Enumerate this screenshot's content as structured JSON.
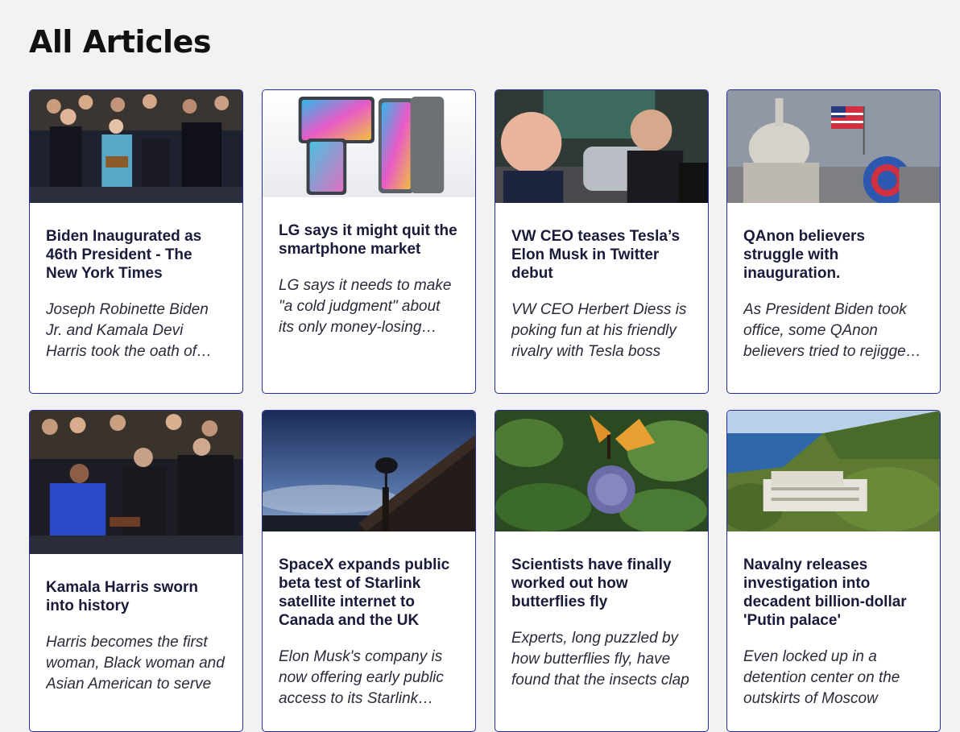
{
  "page": {
    "title": "All Articles"
  },
  "articles": [
    {
      "headline": "Biden Inaugurated as 46th President - The New York Times",
      "description": "Joseph Robinette Biden Jr. and Kamala Devi Harris took the oath of office",
      "image": "inauguration-photo"
    },
    {
      "headline": "LG says it might quit the smartphone market",
      "description": "LG says it needs to make \"a cold judgment\" about its only money-losing division",
      "image": "lg-phones-photo"
    },
    {
      "headline": "VW CEO teases Tesla’s Elon Musk in Twitter debut",
      "description": "VW CEO Herbert Diess is poking fun at his friendly rivalry with Tesla boss",
      "image": "vw-musk-photo"
    },
    {
      "headline": "QAnon believers struggle with inauguration.",
      "description": "As President Biden took office, some QAnon believers tried to rejigger their theories",
      "image": "capitol-qanon-photo"
    },
    {
      "headline": "Kamala Harris sworn into history",
      "description": "Harris becomes the first woman, Black woman and Asian American to serve",
      "image": "harris-sworn-in-photo"
    },
    {
      "headline": "SpaceX expands public beta test of Starlink satellite internet to Canada and the UK",
      "description": "Elon Musk's company is now offering early public access to its Starlink service",
      "image": "starlink-dish-photo"
    },
    {
      "headline": "Scientists have finally worked out how butterflies fly",
      "description": "Experts, long puzzled by how butterflies fly, have found that the insects clap",
      "image": "butterfly-photo"
    },
    {
      "headline": "Navalny releases investigation into decadent billion-dollar 'Putin palace'",
      "description": "Even locked up in a detention center on the outskirts of Moscow",
      "image": "palace-aerial-photo"
    }
  ]
}
